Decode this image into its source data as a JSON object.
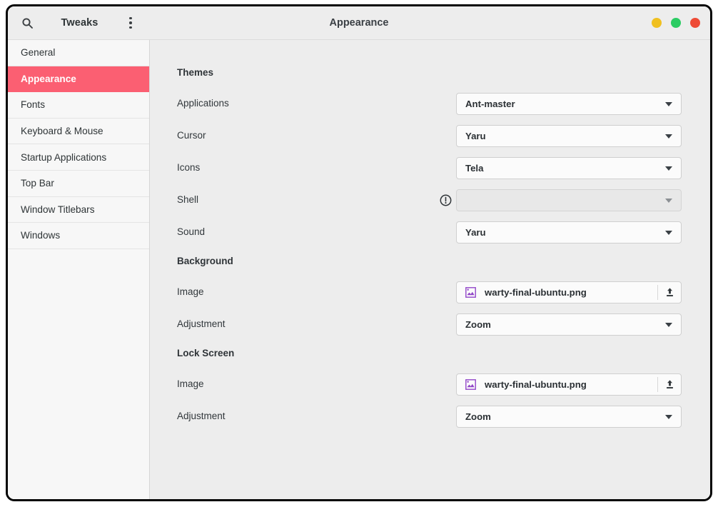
{
  "window": {
    "app_title": "Tweaks",
    "page_title": "Appearance",
    "search_icon": "search-icon",
    "menu_icon": "menu-kebab-icon",
    "controls": [
      {
        "name": "minimize",
        "color": "#f0c020"
      },
      {
        "name": "maximize",
        "color": "#2bcc63"
      },
      {
        "name": "close",
        "color": "#ee4b36"
      }
    ]
  },
  "sidebar": {
    "items": [
      {
        "label": "General",
        "selected": false
      },
      {
        "label": "Appearance",
        "selected": true
      },
      {
        "label": "Fonts",
        "selected": false
      },
      {
        "label": "Keyboard & Mouse",
        "selected": false
      },
      {
        "label": "Startup Applications",
        "selected": false
      },
      {
        "label": "Top Bar",
        "selected": false
      },
      {
        "label": "Window Titlebars",
        "selected": false
      },
      {
        "label": "Windows",
        "selected": false
      }
    ],
    "selected_color": "#fb5f72"
  },
  "content": {
    "sections": [
      {
        "title": "Themes",
        "rows": [
          {
            "label": "Applications",
            "type": "combo",
            "value": "Ant-master",
            "disabled": false,
            "warning": false
          },
          {
            "label": "Cursor",
            "type": "combo",
            "value": "Yaru",
            "disabled": false,
            "warning": false
          },
          {
            "label": "Icons",
            "type": "combo",
            "value": "Tela",
            "disabled": false,
            "warning": false
          },
          {
            "label": "Shell",
            "type": "combo",
            "value": "",
            "disabled": true,
            "warning": true
          },
          {
            "label": "Sound",
            "type": "combo",
            "value": "Yaru",
            "disabled": false,
            "warning": false
          }
        ]
      },
      {
        "title": "Background",
        "rows": [
          {
            "label": "Image",
            "type": "file",
            "value": "warty-final-ubuntu.png",
            "disabled": false,
            "warning": false
          },
          {
            "label": "Adjustment",
            "type": "combo",
            "value": "Zoom",
            "disabled": false,
            "warning": false
          }
        ]
      },
      {
        "title": "Lock Screen",
        "rows": [
          {
            "label": "Image",
            "type": "file",
            "value": "warty-final-ubuntu.png",
            "disabled": false,
            "warning": false
          },
          {
            "label": "Adjustment",
            "type": "combo",
            "value": "Zoom",
            "disabled": false,
            "warning": false
          }
        ]
      }
    ],
    "icons": {
      "file_image": "image-file-icon",
      "upload": "upload-icon",
      "warning": "warning-circle-icon",
      "dropdown": "chevron-down-icon"
    },
    "file_icon_color": "#9146c8"
  }
}
